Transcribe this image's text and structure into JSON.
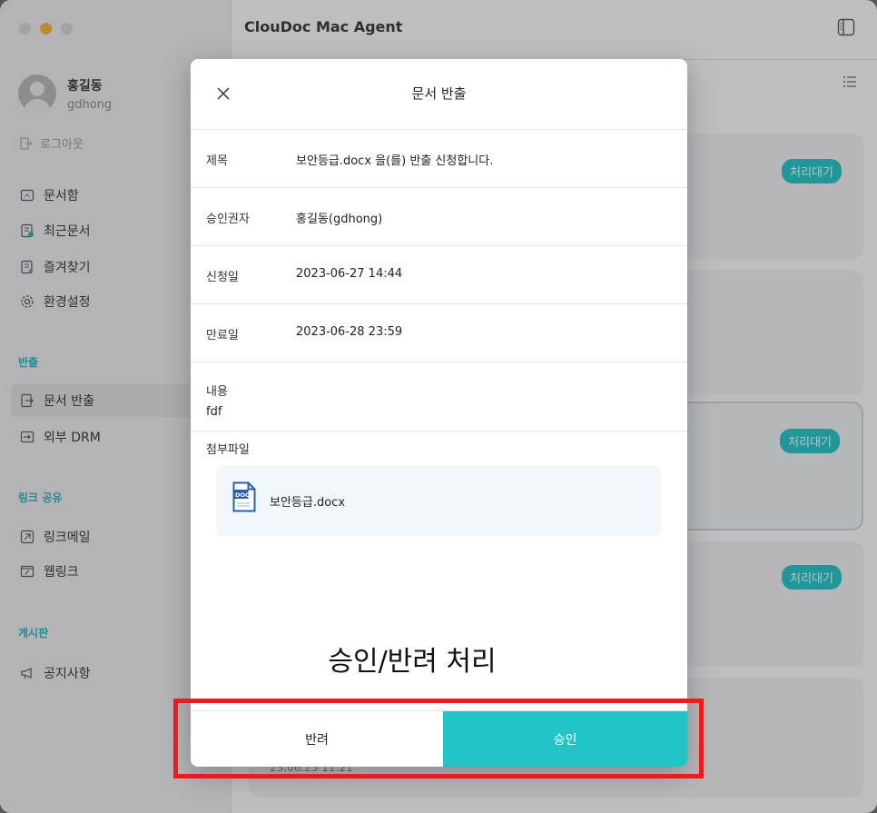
{
  "window": {
    "title": "ClouDoc Mac Agent",
    "traffic_colors": [
      "#d9d9db",
      "#f6b73c",
      "#d9d9db"
    ]
  },
  "profile": {
    "name": "홍길동",
    "id": "gdhong",
    "logout": "로그아웃"
  },
  "sidebar": {
    "items": [
      {
        "label": "문서함",
        "icon": "folder-icon"
      },
      {
        "label": "최근문서",
        "icon": "recent-doc-icon"
      },
      {
        "label": "즐겨찾기",
        "icon": "favorite-doc-icon"
      },
      {
        "label": "환경설정",
        "icon": "gear-icon"
      }
    ],
    "section_export": "반출",
    "export_items": [
      {
        "label": "문서 반출",
        "icon": "export-icon"
      },
      {
        "label": "외부 DRM",
        "icon": "external-drm-icon"
      }
    ],
    "section_link": "링크 공유",
    "link_items": [
      {
        "label": "링크메일",
        "icon": "link-mail-icon"
      },
      {
        "label": "웹링크",
        "icon": "web-link-icon"
      }
    ],
    "section_board": "게시판",
    "board_items": [
      {
        "label": "공지사항",
        "icon": "megaphone-icon"
      }
    ]
  },
  "main": {
    "badges": [
      "처리대기",
      "처리대기",
      "처리대기"
    ],
    "bottom_date": "23.06.23 11:21"
  },
  "modal": {
    "title": "문서 반출",
    "fields": [
      {
        "label": "제목",
        "value": "보안등급.docx 을(를) 반출 신청합니다."
      },
      {
        "label": "승인권자",
        "value": "홍길동(gdhong)"
      },
      {
        "label": "신청일",
        "value": "2023-06-27 14:44"
      },
      {
        "label": "만료일",
        "value": "2023-06-28 23:59"
      }
    ],
    "content_label": "내용",
    "content_value": "fdf",
    "attach_label": "첨부파일",
    "attachment": {
      "name": "보안등급.docx",
      "icon_text": "DOC"
    },
    "reject_label": "반려",
    "approve_label": "승인"
  },
  "annotation": {
    "callout": "승인/반려 처리",
    "highlight_color": "#ec1c1c"
  }
}
